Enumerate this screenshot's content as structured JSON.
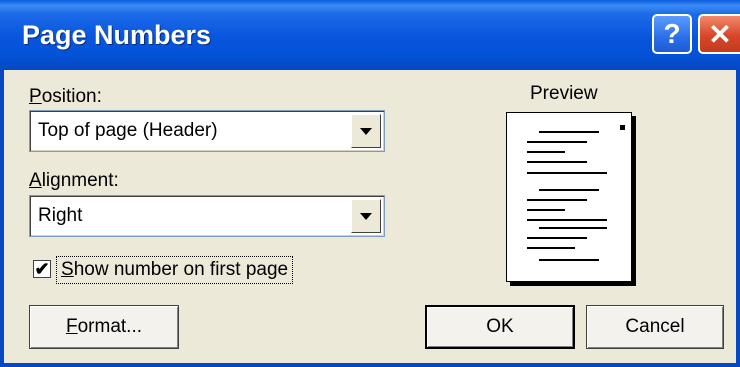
{
  "window": {
    "title": "Page Numbers",
    "help_label": "?",
    "close_label": "✕"
  },
  "position": {
    "label_prefix": "",
    "label_mnemonic": "P",
    "label_rest": "osition:",
    "value": "Top of page (Header)"
  },
  "alignment": {
    "label_mnemonic": "A",
    "label_rest": "lignment:",
    "value": "Right"
  },
  "first_page": {
    "checked": true,
    "check_mark": "✔",
    "label_mnemonic": "S",
    "label_rest": "how number on first page"
  },
  "preview": {
    "label": "Preview"
  },
  "buttons": {
    "format_mnemonic": "F",
    "format_rest": "ormat...",
    "ok": "OK",
    "cancel": "Cancel"
  },
  "colors": {
    "titlebar": "#0655DC",
    "dialog_bg": "#ECE9D8",
    "close_button": "#D8472A"
  },
  "icons": {
    "help": "help-icon",
    "close": "close-icon",
    "dropdown": "chevron-down-icon",
    "checkbox": "checkmark-icon"
  }
}
